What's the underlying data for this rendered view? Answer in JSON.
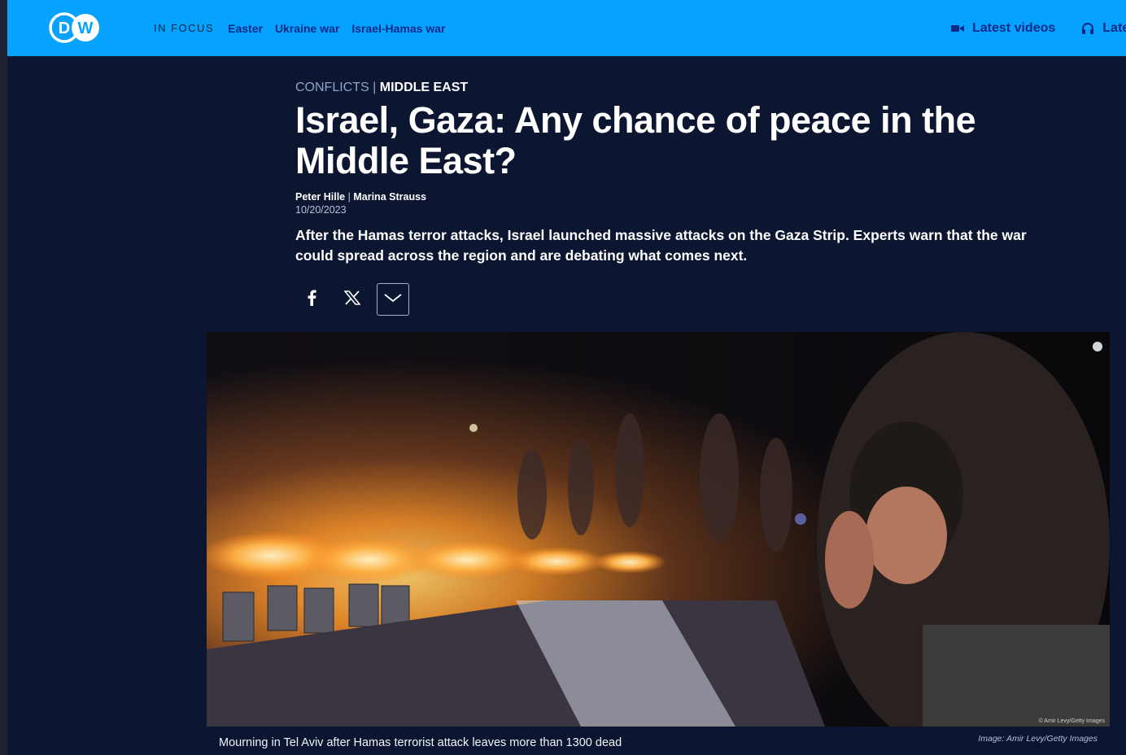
{
  "header": {
    "logo_text": "DW",
    "in_focus_label": "IN FOCUS",
    "focus_links": [
      "Easter",
      "Ukraine war",
      "Israel-Hamas war"
    ],
    "latest_videos_label": "Latest videos",
    "latest_audio_label": "Latest audio"
  },
  "article": {
    "category": "CONFLICTS",
    "separator": "|",
    "subcategory": "MIDDLE EAST",
    "title": "Israel, Gaza: Any chance of peace in the Middle East?",
    "authors": [
      "Peter Hille",
      "Marina Strauss"
    ],
    "author_separator": "|",
    "date": "10/20/2023",
    "teaser": "After the Hamas terror attacks, Israel launched massive attacks on the Gaza Strip. Experts warn that the war could spread across the region and are debating what comes next."
  },
  "share": {
    "buttons": [
      "facebook-icon",
      "x-icon",
      "chevron-down-icon"
    ]
  },
  "image": {
    "caption": "Mourning in Tel Aviv after Hamas terrorist attack leaves more than 1300 dead",
    "credit": "Image: Amir Levy/Getty Images",
    "overlay_credit": "© Amir Levy/Getty Images"
  },
  "colors": {
    "header_bg": "#05a3ff",
    "page_bg": "#0c1631",
    "nav_text": "#0b2a86"
  }
}
